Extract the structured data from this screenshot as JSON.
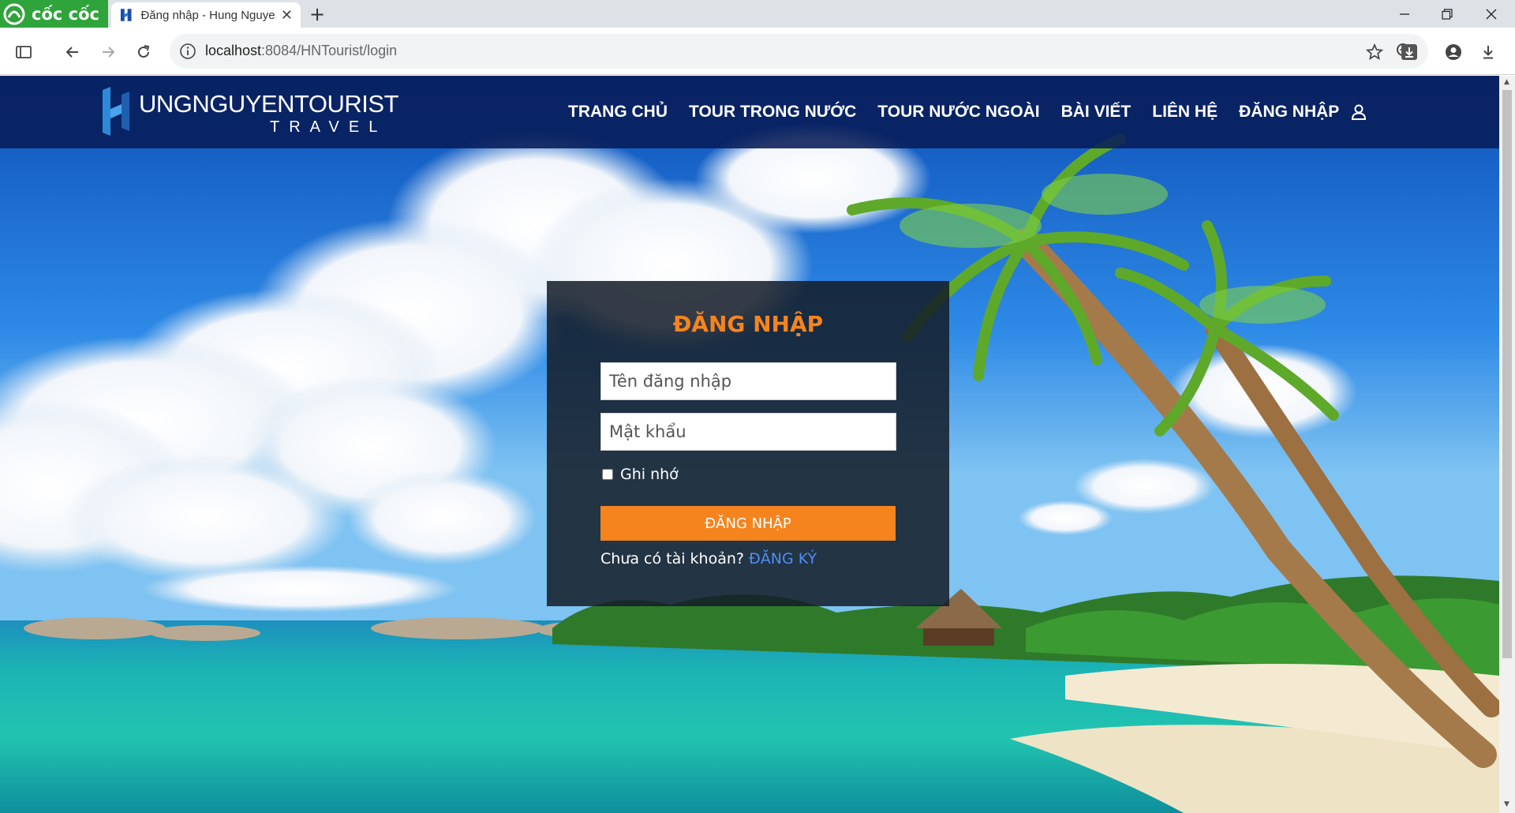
{
  "browser": {
    "brand": "cốc cốc",
    "tab_title": "Đăng nhập - Hung Nguye",
    "url_host": "localhost",
    "url_path": ":8084/HNTourist/login"
  },
  "site": {
    "logo_line1": "UNGNGUYENTOURIST",
    "logo_line2": "TRAVEL",
    "nav": [
      "TRANG CHỦ",
      "TOUR TRONG NƯỚC",
      "TOUR NƯỚC NGOÀI",
      "BÀI VIẾT",
      "LIÊN HỆ",
      "ĐĂNG NHẬP"
    ]
  },
  "login": {
    "title": "ĐĂNG NHẬP",
    "username_placeholder": "Tên đăng nhập",
    "password_placeholder": "Mật khẩu",
    "remember_label": "Ghi nhớ",
    "submit_label": "ĐĂNG NHẬP",
    "no_account_text": "Chưa có tài khoản?",
    "register_link": "ĐĂNG KÝ"
  },
  "colors": {
    "accent": "#f5841f",
    "header_bg": "#081c58",
    "link": "#4d8ef5",
    "browser_green": "#2fa43a"
  }
}
